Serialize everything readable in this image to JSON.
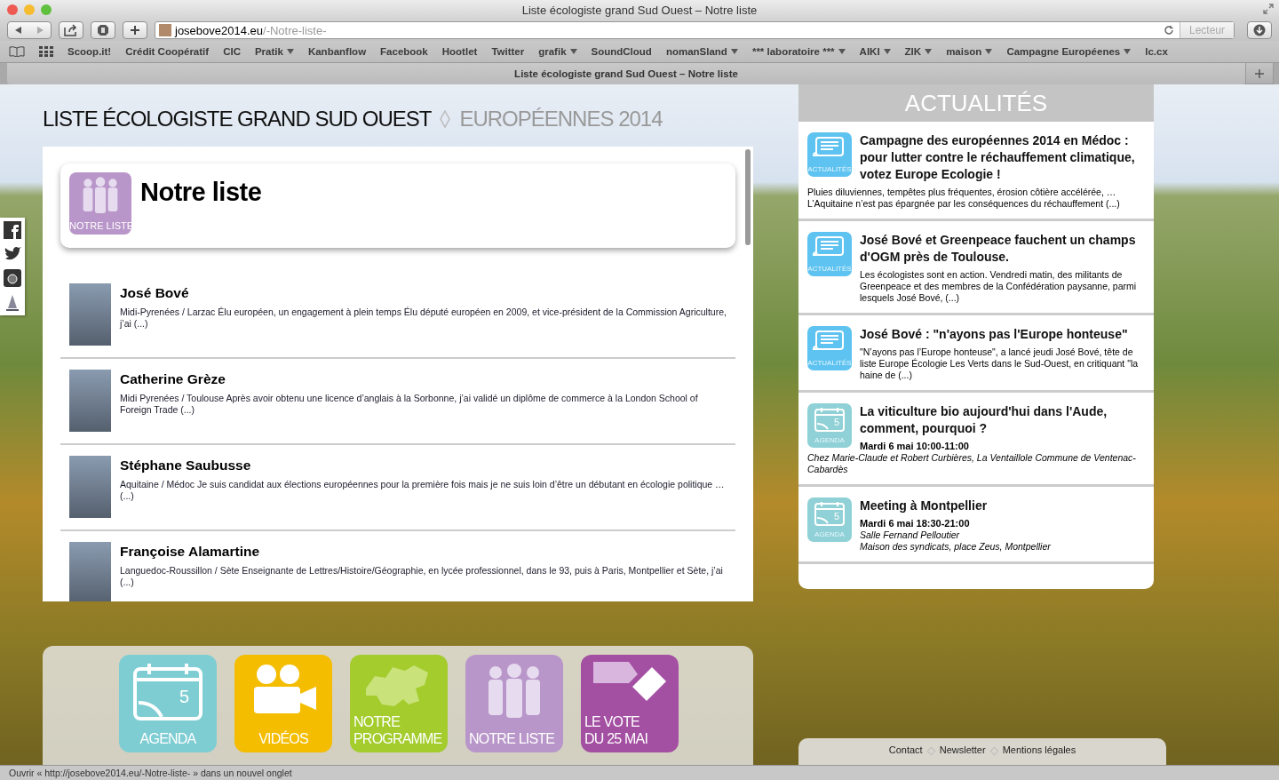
{
  "window": {
    "title": "Liste écologiste grand Sud Ouest – Notre liste"
  },
  "toolbar": {
    "url_domain": "josebove2014.eu",
    "url_path": "/-Notre-liste-",
    "reader_button": "Lecteur"
  },
  "bookmarks": [
    {
      "label": "Scoop.it!",
      "has_menu": false
    },
    {
      "label": "Crédit Coopératif",
      "has_menu": false
    },
    {
      "label": "CIC",
      "has_menu": false
    },
    {
      "label": "Pratik",
      "has_menu": true
    },
    {
      "label": "Kanbanflow",
      "has_menu": false
    },
    {
      "label": "Facebook",
      "has_menu": false
    },
    {
      "label": "Hootlet",
      "has_menu": false
    },
    {
      "label": "Twitter",
      "has_menu": false
    },
    {
      "label": "grafik",
      "has_menu": true
    },
    {
      "label": "SoundCloud",
      "has_menu": false
    },
    {
      "label": "nomanSland",
      "has_menu": true
    },
    {
      "label": "*** laboratoire ***",
      "has_menu": true
    },
    {
      "label": "AIKI",
      "has_menu": true
    },
    {
      "label": "ZIK",
      "has_menu": true
    },
    {
      "label": "maison",
      "has_menu": true
    },
    {
      "label": "Campagne Européenes",
      "has_menu": true
    },
    {
      "label": "lc.cx",
      "has_menu": false
    }
  ],
  "tab": {
    "title": "Liste écologiste grand Sud Ouest – Notre liste"
  },
  "site": {
    "title": "LISTE ÉCOLOGISTE GRAND SUD OUEST",
    "subtitle": "EUROPÉENNES 2014"
  },
  "social": [
    {
      "kind": "facebook"
    },
    {
      "kind": "twitter"
    },
    {
      "kind": "instagram"
    },
    {
      "kind": "logo"
    }
  ],
  "page_header": {
    "title": "Notre liste",
    "icon_label": "NOTRE LISTE"
  },
  "candidates": [
    {
      "name": "José Bové",
      "text": "Midi-Pyrenées / Larzac Élu européen, un engagement à plein temps Élu député européen en 2009, et vice-président de la Commission Agriculture, j’ai (...)"
    },
    {
      "name": "Catherine Grèze",
      "text": "Midi Pyrenées / Toulouse Après avoir obtenu une licence d’anglais à la Sorbonne, j’ai validé un diplôme de commerce à la London School of Foreign Trade (...)"
    },
    {
      "name": "Stéphane Saubusse",
      "text": "Aquitaine / Médoc Je suis candidat aux élections européennes pour la première fois mais je ne suis loin d’être un débutant en écologie politique … (...)"
    },
    {
      "name": "Françoise Alamartine",
      "text": "Languedoc-Roussillon / Sète Enseignante de Lettres/Histoire/Géographie, en lycée professionnel, dans le 93, puis à Paris, Montpellier et Sète, j’ai (...)"
    }
  ],
  "news": {
    "heading": "ACTUALITÉS",
    "items": [
      {
        "kind": "actualite",
        "icon_label": "ACTUALITÉS",
        "title": "Campagne des européennes 2014 en Médoc : pour lutter contre le réchauffement climatique, votez Europe Ecologie !",
        "summary": "Pluies diluviennes, tempêtes plus fréquentes, érosion côtière accélérée, … L’Aquitaine n’est pas épargnée par les conséquences du réchauffement (...)"
      },
      {
        "kind": "actualite",
        "icon_label": "ACTUALITÉS",
        "title": "José Bové et Greenpeace fauchent un champs d'OGM près de Toulouse.",
        "summary": "Les écologistes sont en action. Vendredi matin, des militants de Greenpeace et des membres de la Confédération paysanne, parmi lesquels José Bové, (...)"
      },
      {
        "kind": "actualite",
        "icon_label": "ACTUALITÉS",
        "title": "José Bové : \"n'ayons pas l'Europe honteuse\"",
        "summary": "\"N’ayons pas l’Europe honteuse\", a lancé jeudi José Bové, tête de liste Europe Écologie Les Verts dans le Sud-Ouest, en critiquant \"la haine de (...)"
      },
      {
        "kind": "agenda",
        "icon_label": "AGENDA",
        "icon_day": "5",
        "title": "La viticulture bio aujourd'hui dans l'Aude, comment, pourquoi ?",
        "date": "Mardi 6 mai 10:00-11:00",
        "place_lines": [
          "Chez Marie-Claude et Robert Curbières, La Ventaillole Commune de Ventenac-Cabardès"
        ]
      },
      {
        "kind": "agenda",
        "icon_label": "AGENDA",
        "icon_day": "5",
        "title": "Meeting à Montpellier",
        "date": "Mardi 6 mai 18:30-21:00",
        "place_lines": [
          "Salle Fernand Pelloutier",
          "Maison des syndicats, place Zeus, Montpellier"
        ]
      }
    ]
  },
  "tiles": [
    {
      "kind": "agenda",
      "color": "#7ecdd3",
      "label_lines": [
        "AGENDA"
      ],
      "icon_day": "5"
    },
    {
      "kind": "videos",
      "color": "#f4bd00",
      "label_lines": [
        "VIDÉOS"
      ]
    },
    {
      "kind": "programme",
      "color": "#a3cc2c",
      "label_lines": [
        "NOTRE",
        "PROGRAMME"
      ]
    },
    {
      "kind": "liste",
      "color": "#b896c9",
      "label_lines": [
        "NOTRE LISTE"
      ]
    },
    {
      "kind": "vote",
      "color": "#a34fa2",
      "label_lines": [
        "LE VOTE",
        "DU 25 MAI"
      ]
    }
  ],
  "footer": {
    "links": [
      "Contact",
      "Newsletter",
      "Mentions légales"
    ]
  },
  "status_bar": {
    "text": "Ouvrir « http://josebove2014.eu/-Notre-liste- » dans un nouvel onglet"
  }
}
